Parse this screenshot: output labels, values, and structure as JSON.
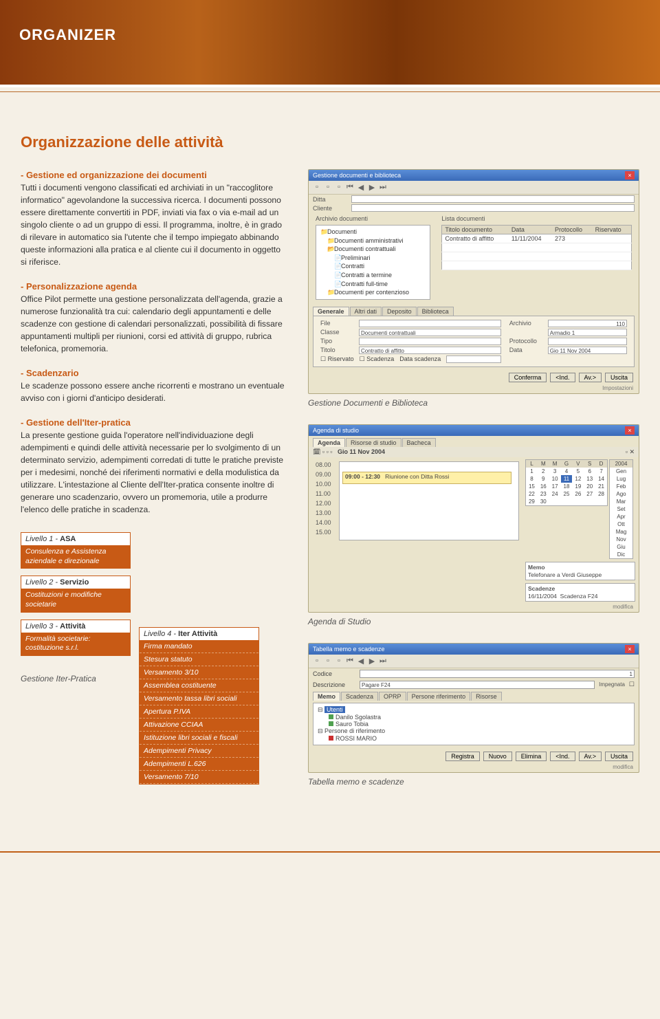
{
  "page": {
    "banner_title": "ORGANIZER",
    "section_title": "Organizzazione delle attività"
  },
  "blocks": {
    "b1_lead": "- Gestione ed organizzazione dei documenti",
    "b1_text": "Tutti i documenti vengono classificati ed archiviati in un \"raccoglitore informatico\" agevolandone la successiva ricerca. I documenti possono essere direttamente convertiti in PDF, inviati via fax o via e-mail ad un singolo cliente o ad un gruppo di essi. Il programma, inoltre, è in grado di rilevare in automatico sia l'utente che il tempo impiegato abbinando queste informazioni alla pratica e al cliente cui il documento in oggetto si riferisce.",
    "b2_lead": "- Personalizzazione agenda",
    "b2_text": "Office Pilot permette una gestione personalizzata dell'agenda, grazie a numerose funzionalità tra cui: calendario degli appuntamenti e delle scadenze con gestione di calendari personalizzati, possibilità di fissare appuntamenti multipli per riunioni, corsi ed attività di gruppo, rubrica telefonica, promemoria.",
    "b3_lead": "- Scadenzario",
    "b3_text": "Le scadenze possono essere anche ricorrenti e mostrano un eventuale avviso con i giorni d'anticipo desiderati.",
    "b4_lead": "- Gestione dell'Iter-pratica",
    "b4_text": "La presente gestione guida l'operatore nell'individuazione degli adempimenti e quindi delle attività necessarie per lo svolgimento di un determinato servizio, adempimenti corredati di tutte le pratiche previste per i medesimi, nonché dei riferimenti normativi e della modulistica da utilizzare. L'intestazione al Cliente dell'Iter-pratica consente inoltre di generare uno scadenzario, ovvero un promemoria, utile a produrre l'elenco delle pratiche in scadenza."
  },
  "captions": {
    "c1": "Gestione Documenti e Biblioteca",
    "c2": "Agenda di Studio",
    "c3": "Tabella memo e scadenze",
    "hier": "Gestione Iter-Pratica"
  },
  "screenshot1": {
    "title": "Gestione documenti e biblioteca",
    "label_ditta": "Ditta",
    "label_cliente": "Cliente",
    "label_archivio": "Archivio documenti",
    "label_lista": "Lista documenti",
    "cols": {
      "c1": "Titolo documento",
      "c2": "Data",
      "c3": "Protocollo",
      "c4": "Riservato"
    },
    "row1": {
      "c1": "Contratto di affitto",
      "c2": "11/11/2004",
      "c3": "273",
      "c4": ""
    },
    "tree": {
      "root": "Documenti",
      "n1": "Documenti amministrativi",
      "n2": "Documenti contrattuali",
      "n2a": "Preliminari",
      "n2b": "Contratti",
      "n2c": "Contratti a termine",
      "n2d": "Contratti full-time",
      "n3": "Documenti per contenzioso"
    },
    "tabs": {
      "t1": "Generale",
      "t2": "Altri dati",
      "t3": "Deposito",
      "t4": "Biblioteca"
    },
    "form": {
      "file": "File",
      "classe": "Classe",
      "classe_v": "Documenti contrattuali",
      "tipo": "Tipo",
      "titolo": "Titolo",
      "titolo_v": "Contratto di affitto",
      "riservato": "Riservato",
      "scadenza": "Scadenza",
      "data_scad": "Data scadenza",
      "archivio": "Archivio",
      "archivio_v": "110",
      "armadio": "Armadio 1",
      "protocollo": "Protocollo",
      "data": "Data",
      "data_v": "Gio 11 Nov 2004"
    },
    "buttons": {
      "conferma": "Conferma",
      "ind": "<Ind.",
      "av": "Av.>",
      "uscita": "Uscita",
      "imp": "Impostazioni"
    }
  },
  "screenshot2": {
    "title": "Agenda di studio",
    "tabs": {
      "t1": "Agenda",
      "t2": "Risorse di studio",
      "t3": "Bacheca"
    },
    "date": "Gio 11 Nov 2004",
    "event_time": "09:00 - 12:30",
    "event_text": "Riunione con Ditta Rossi",
    "times": [
      "08.00",
      "09.00",
      "10.00",
      "11.00",
      "12.00",
      "13.00",
      "14.00",
      "15.00"
    ],
    "dow": [
      "L",
      "M",
      "M",
      "G",
      "V",
      "S",
      "D"
    ],
    "year": "2004",
    "months": [
      "Gen",
      "Lug",
      "Feb",
      "Ago",
      "Mar",
      "Set",
      "Apr",
      "Ott",
      "Mag",
      "Nov",
      "Giu",
      "Dic"
    ],
    "days": [
      "1",
      "2",
      "3",
      "4",
      "5",
      "6",
      "7",
      "8",
      "9",
      "10",
      "11",
      "12",
      "13",
      "14",
      "15",
      "16",
      "17",
      "18",
      "19",
      "20",
      "21",
      "22",
      "23",
      "24",
      "25",
      "26",
      "27",
      "28",
      "29",
      "30"
    ],
    "memo_title": "Memo",
    "memo_line": "Telefonare a Verdi Giuseppe",
    "scad_title": "Scadenze",
    "scad_line1": "16/11/2004",
    "scad_line2": "Scadenza F24",
    "modifica": "modifica"
  },
  "screenshot3": {
    "title": "Tabella memo e scadenze",
    "codice": "Codice",
    "codice_v": "1",
    "descr": "Descrizione",
    "descr_v": "Pagare F24",
    "impegnata": "Impegnata",
    "tabs": {
      "t1": "Memo",
      "t2": "Scadenza",
      "t3": "OPRP",
      "t4": "Persone riferimento",
      "t5": "Risorse"
    },
    "tree_hdr": "Utenti",
    "u1": "Danilo Sgolastra",
    "u2": "Sauro Tobia",
    "grp": "Persone di riferimento",
    "p1": "ROSSI MARIO",
    "buttons": {
      "registra": "Registra",
      "nuovo": "Nuovo",
      "elimina": "Elimina",
      "ind": "<Ind.",
      "av": "Av.>",
      "uscita": "Uscita",
      "modifica": "modifica"
    }
  },
  "hierarchy": {
    "l1_head": "Livello 1 - ",
    "l1_bold": "ASA",
    "l1_body": "Consulenza e Assistenza aziendale e direzionale",
    "l2_head": "Livello 2 - ",
    "l2_bold": "Servizio",
    "l2_body": "Costituzioni e modifiche societarie",
    "l3_head": "Livello 3 - ",
    "l3_bold": "Attività",
    "l3_body": "Formalità societarie: costituzione s.r.l.",
    "l4_head": "Livello 4 - ",
    "l4_bold": "Iter Attività",
    "items": [
      "Firma mandato",
      "Stesura statuto",
      "Versamento 3/10",
      "Assemblea costituente",
      "Versamento tassa libri sociali",
      "Apertura P.IVA",
      "Attivazione CCIAA",
      "Istituzione libri sociali e fiscali",
      "Adempimenti Privacy",
      "Adempimenti L.626",
      "Versamento 7/10"
    ]
  }
}
